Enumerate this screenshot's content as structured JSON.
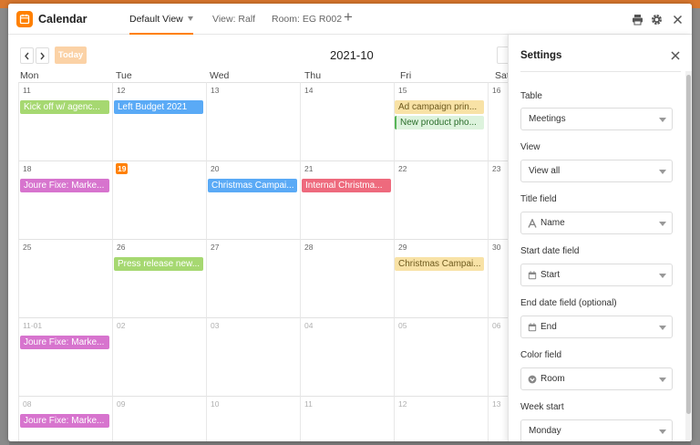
{
  "app": {
    "title": "Calendar",
    "brand_color": "#ff8000"
  },
  "tabs": [
    {
      "label": "Default View",
      "active": true
    },
    {
      "label": "View: Ralf",
      "active": false
    },
    {
      "label": "Room: EG R002",
      "active": false
    }
  ],
  "header_icons": [
    "print-icon",
    "gear-icon",
    "close-icon"
  ],
  "calendar": {
    "month_label": "2021-10",
    "today_label": "Today",
    "weekdays": [
      "Mon",
      "Tue",
      "Wed",
      "Thu",
      "Fri",
      "Sat"
    ],
    "weeks": [
      [
        "11",
        "12",
        "13",
        "14",
        "15",
        "16"
      ],
      [
        "18",
        "19",
        "20",
        "21",
        "22",
        "23"
      ],
      [
        "25",
        "26",
        "27",
        "28",
        "29",
        "30"
      ],
      [
        "11-01",
        "02",
        "03",
        "04",
        "05",
        "06"
      ],
      [
        "08",
        "09",
        "10",
        "11",
        "12",
        "13"
      ]
    ],
    "today_marker": "19",
    "events": [
      {
        "label": "Kick off w/ agenc...",
        "color": "green"
      },
      {
        "label": "Left Budget 2021",
        "color": "blue"
      },
      {
        "label": "Ad campaign prin...",
        "color": "yellow"
      },
      {
        "label": "New product pho...",
        "color": "green-light"
      },
      {
        "label": "Joure Fixe: Marke...",
        "color": "purple"
      },
      {
        "label": "Christmas Campai...",
        "color": "blue"
      },
      {
        "label": "Internal Christma...",
        "color": "red"
      },
      {
        "label": "Press release new...",
        "color": "green"
      },
      {
        "label": "Christmas Campai...",
        "color": "yellow"
      },
      {
        "label": "Joure Fixe: Marke...",
        "color": "purple"
      },
      {
        "label": "Joure Fixe: Marke...",
        "color": "purple"
      }
    ]
  },
  "settings": {
    "title": "Settings",
    "fields": [
      {
        "label": "Table",
        "value": "Meetings",
        "icon": ""
      },
      {
        "label": "View",
        "value": "View all",
        "icon": ""
      },
      {
        "label": "Title field",
        "value": "Name",
        "icon": "text-a-icon"
      },
      {
        "label": "Start date field",
        "value": "Start",
        "icon": "calendar-icon"
      },
      {
        "label": "End date field (optional)",
        "value": "End",
        "icon": "calendar-icon"
      },
      {
        "label": "Color field",
        "value": "Room",
        "icon": "single-select-icon"
      },
      {
        "label": "Week start",
        "value": "Monday",
        "icon": ""
      }
    ]
  }
}
